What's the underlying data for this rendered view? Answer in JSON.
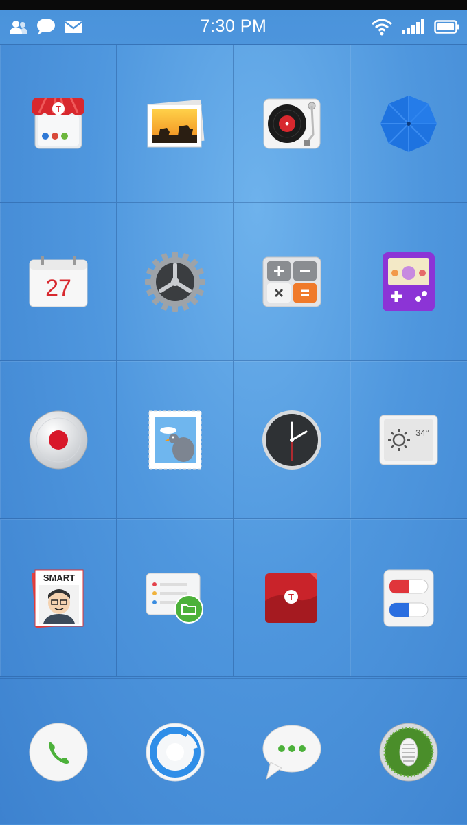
{
  "status_bar": {
    "time": "7:30 PM",
    "left_icons": [
      "contacts-icon",
      "chat-bubble-icon",
      "mail-icon"
    ],
    "right_icons": [
      "wifi-icon",
      "signal-icon",
      "battery-icon"
    ]
  },
  "apps": [
    {
      "name": "app-store-icon"
    },
    {
      "name": "gallery-icon"
    },
    {
      "name": "music-player-icon"
    },
    {
      "name": "umbrella-icon"
    },
    {
      "name": "calendar-icon",
      "text": "27"
    },
    {
      "name": "settings-gear-icon"
    },
    {
      "name": "calculator-icon"
    },
    {
      "name": "game-console-icon"
    },
    {
      "name": "recorder-icon"
    },
    {
      "name": "mail-stamp-icon"
    },
    {
      "name": "clock-icon"
    },
    {
      "name": "weather-icon",
      "text": "34°"
    },
    {
      "name": "contact-card-icon",
      "text": "SMART"
    },
    {
      "name": "file-manager-icon"
    },
    {
      "name": "notes-icon"
    },
    {
      "name": "pills-icon"
    }
  ],
  "dock": [
    {
      "name": "phone-icon"
    },
    {
      "name": "browser-icon"
    },
    {
      "name": "messages-icon"
    },
    {
      "name": "camera-icon"
    }
  ],
  "colors": {
    "wallpaper": "#4f97de",
    "status_bar": "#4a93db",
    "accent_red": "#d8282e",
    "accent_green": "#4cb13a"
  }
}
